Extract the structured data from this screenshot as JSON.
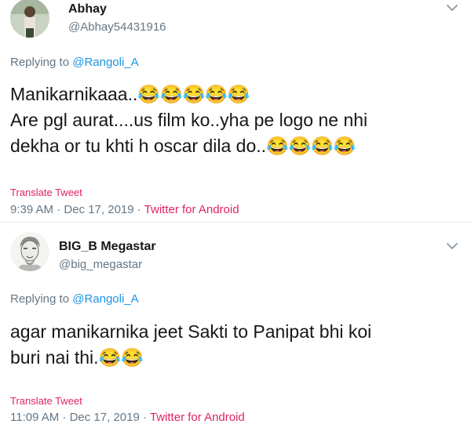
{
  "tweets": [
    {
      "name": "Abhay",
      "handle": "@Abhay54431916",
      "replying_prefix": "Replying to",
      "replying_to": "@Rangoli_A",
      "lines": [
        "Manikarnikaaa..😂😂😂😂😂",
        "Are pgl aurat....us film ko..yha pe logo ne nhi",
        "dekha or tu khti h oscar dila do..😂😂😂😂"
      ],
      "translate": "Translate Tweet",
      "time": "9:39 AM · Dec 17, 2019 · ",
      "source": "Twitter for Android",
      "avatar_icon": "user-avatar-photo"
    },
    {
      "name": "BIG_B Megastar",
      "handle": "@big_megastar",
      "replying_prefix": "Replying to",
      "replying_to": "@Rangoli_A",
      "lines": [
        "agar manikarnika jeet Sakti to Panipat bhi koi",
        "buri nai thi.😂😂"
      ],
      "translate": "Translate Tweet",
      "time": "11:09 AM · Dec 17, 2019 · ",
      "source": "Twitter for Android",
      "avatar_icon": "sketch-portrait-avatar"
    }
  ],
  "colors": {
    "link_blue": "#1b95e0",
    "secondary_gray": "#657786",
    "accent_red": "#e0245e",
    "text_dark": "#14171a"
  }
}
